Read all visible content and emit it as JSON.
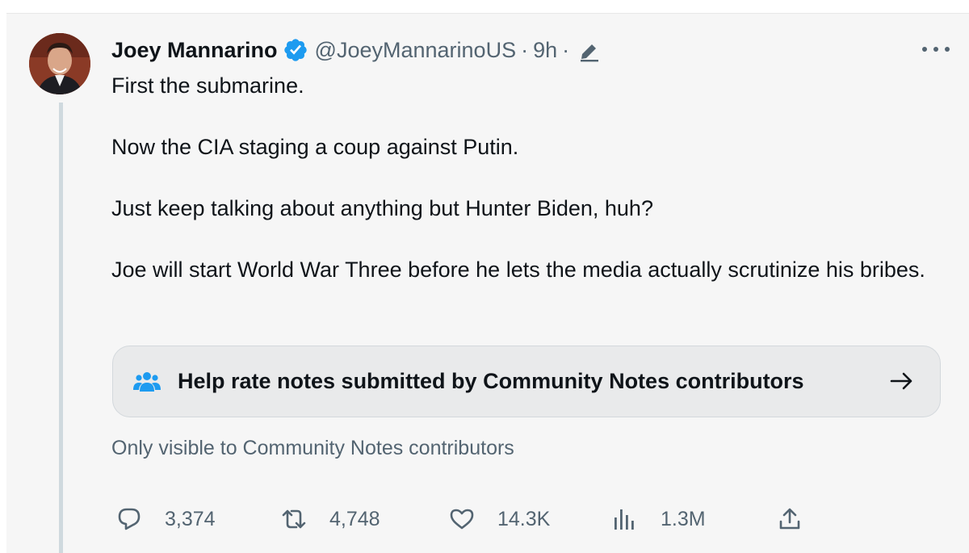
{
  "tweet": {
    "author": {
      "name": "Joey Mannarino",
      "handle": "@JoeyMannarinoUS",
      "verified": true,
      "avatar": "profile-photo"
    },
    "separator": "·",
    "time": "9h",
    "edited": true,
    "text": [
      "First the submarine.",
      "Now the CIA staging a coup against Putin.",
      "Just keep talking about anything but Hunter Biden, huh?",
      "Joe will start World War Three before he lets the media actually scrutinize his bribes."
    ],
    "community_notes": {
      "label": "Help rate notes submitted by Community Notes contributors",
      "icon": "people-icon",
      "visibility": "Only visible to Community Notes contributors"
    },
    "actions": {
      "replies": "3,374",
      "retweets": "4,748",
      "likes": "14.3K",
      "views": "1.3M"
    }
  },
  "colors": {
    "background": "#f6f6f6",
    "text": "#0f1419",
    "secondary": "#536471",
    "verified": "#1d9bf0",
    "notes_icon": "#1d9bf0",
    "card": "#e9eaeb"
  }
}
